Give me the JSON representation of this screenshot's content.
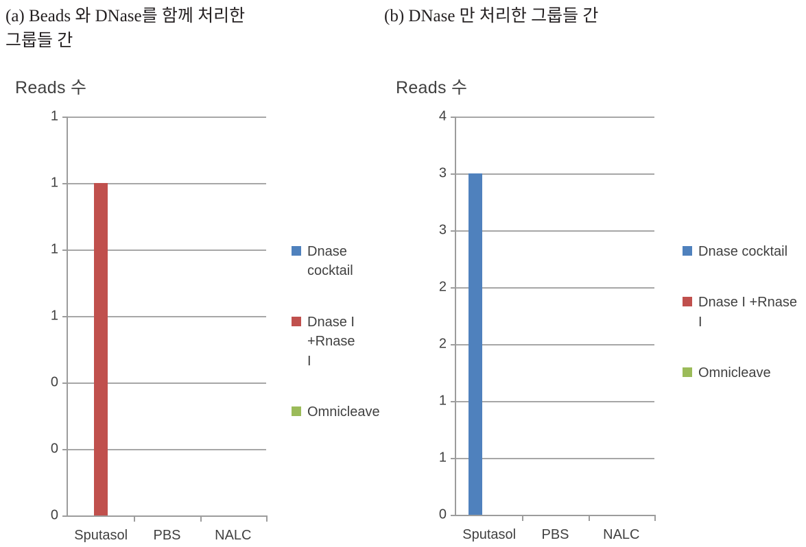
{
  "captions": {
    "a": "(a) Beads 와 DNase를 함께 처리한\n      그룹들 간",
    "b": "(b) DNase 만 처리한 그룹들 간"
  },
  "colors": {
    "series_blue": "#4F81BD",
    "series_red": "#C0504D",
    "series_green": "#9BBB59",
    "axis": "#9C9C9C",
    "gridline": "#A6A6A6",
    "text": "#404040"
  },
  "legend": {
    "items": [
      {
        "label": "Dnase cocktail",
        "color": "#4F81BD"
      },
      {
        "label": "Dnase I +Rnase\n  I",
        "color": "#C0504D"
      },
      {
        "label": "Omnicleave",
        "color": "#9BBB59"
      }
    ]
  },
  "chart_data": [
    {
      "type": "bar",
      "id": "chart-a",
      "title": "Reads 수",
      "xlabel": "",
      "ylabel": "",
      "categories": [
        "Sputasol",
        "PBS",
        "NALC"
      ],
      "ytick_labels": [
        "1",
        "1",
        "1",
        "1",
        "0",
        "0",
        "0"
      ],
      "ytick_values": [
        1.2,
        1.0,
        0.8,
        0.6,
        0.4,
        0.2,
        0
      ],
      "ylim": [
        0,
        1.2
      ],
      "grid": true,
      "legend_position": "right",
      "series": [
        {
          "name": "Dnase cocktail",
          "color": "#4F81BD",
          "values": [
            0,
            0,
            0
          ]
        },
        {
          "name": "Dnase I +Rnase I",
          "color": "#C0504D",
          "values": [
            1,
            0,
            0
          ]
        },
        {
          "name": "Omnicleave",
          "color": "#9BBB59",
          "values": [
            0,
            0,
            0
          ]
        }
      ]
    },
    {
      "type": "bar",
      "id": "chart-b",
      "title": "Reads 수",
      "xlabel": "",
      "ylabel": "",
      "categories": [
        "Sputasol",
        "PBS",
        "NALC"
      ],
      "ytick_labels": [
        "4",
        "3",
        "3",
        "2",
        "2",
        "1",
        "1",
        "0"
      ],
      "ytick_values": [
        3.5,
        3.0,
        2.5,
        2.0,
        1.5,
        1.0,
        0.5,
        0
      ],
      "ylim": [
        0,
        3.5
      ],
      "grid": true,
      "legend_position": "right",
      "series": [
        {
          "name": "Dnase cocktail",
          "color": "#4F81BD",
          "values": [
            3,
            0,
            0
          ]
        },
        {
          "name": "Dnase I +Rnase I",
          "color": "#C0504D",
          "values": [
            0,
            0,
            0
          ]
        },
        {
          "name": "Omnicleave",
          "color": "#9BBB59",
          "values": [
            0,
            0,
            0
          ]
        }
      ]
    }
  ]
}
